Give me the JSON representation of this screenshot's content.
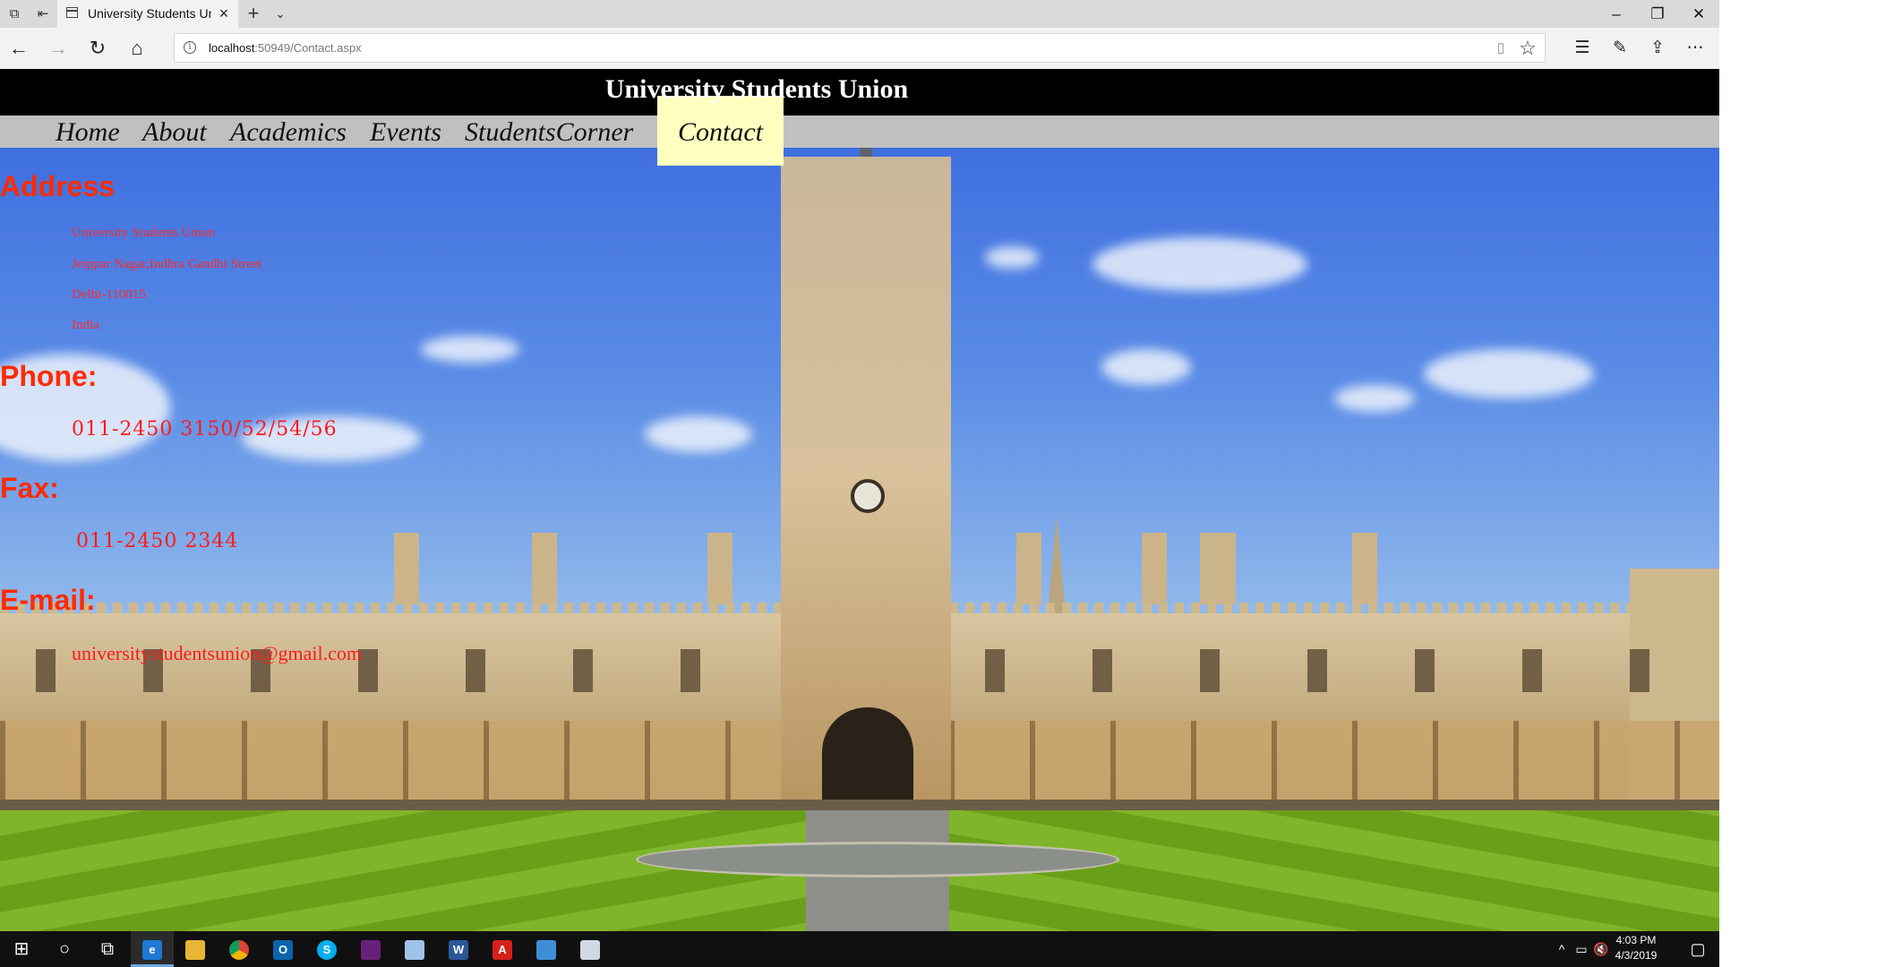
{
  "browser": {
    "tab_title": "University Students Union",
    "url_host": "localhost",
    "url_rest": ":50949/Contact.aspx",
    "icons": [
      "tab-manager-icon",
      "set-aside-tabs-icon",
      "page-icon",
      "close-icon",
      "plus-icon",
      "chevron-down-icon",
      "minimize-icon",
      "restore-icon",
      "back-icon",
      "forward-icon",
      "refresh-icon",
      "home-icon",
      "info-icon",
      "reading-view-icon",
      "star-icon",
      "favorites-icon",
      "pen-icon",
      "share-icon",
      "more-icon"
    ]
  },
  "site": {
    "title": "University Students Union",
    "menu": [
      "Home",
      "About",
      "Academics",
      "Events",
      "StudentsCorner",
      "Contact"
    ],
    "active_menu": "Contact"
  },
  "contact": {
    "address_heading": "Address",
    "address_lines": [
      "University Students Union",
      "Jeippar Nagar,Indhra Gandhi Street",
      "Delhi-110015",
      "India"
    ],
    "phone_heading": "Phone:",
    "phone_value": "011-2450 3150/52/54/56",
    "fax_heading": "Fax:",
    "fax_value": "011-2450 2344",
    "email_heading": "E-mail:",
    "email_value": "universitystudentsunion@gmail.com"
  },
  "taskbar": {
    "time": "4:03 PM",
    "date": "4/3/2019",
    "word_label": "W",
    "acrobat_label": "A",
    "outlook_label": "O",
    "skype_label": "S"
  },
  "colors": {
    "accent_red": "#ff2a00",
    "header_black": "#000000",
    "menu_gray": "#c0c0c0",
    "active_menu_bg": "#ffffc0"
  }
}
